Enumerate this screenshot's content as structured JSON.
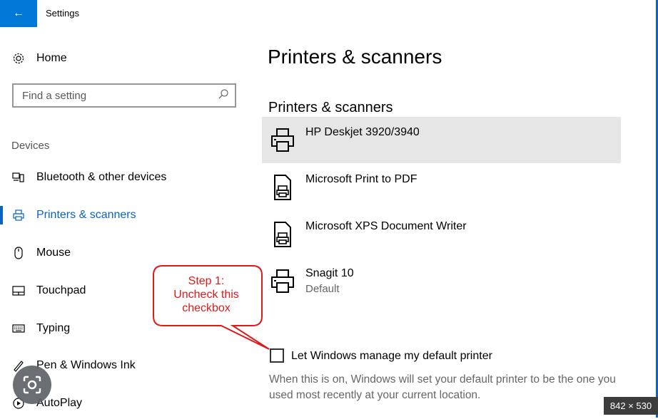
{
  "window": {
    "title": "Settings",
    "back_icon": "arrow-left-icon",
    "accent": "#0078d7"
  },
  "sidebar": {
    "home_label": "Home",
    "search": {
      "placeholder": "Find a setting",
      "value": ""
    },
    "section_label": "Devices",
    "items": [
      {
        "label": "Bluetooth & other devices",
        "icon": "bluetooth-devices-icon"
      },
      {
        "label": "Printers & scanners",
        "icon": "printer-icon",
        "active": true
      },
      {
        "label": "Mouse",
        "icon": "mouse-icon"
      },
      {
        "label": "Touchpad",
        "icon": "touchpad-icon"
      },
      {
        "label": "Typing",
        "icon": "keyboard-icon"
      },
      {
        "label": "Pen & Windows Ink",
        "icon": "pen-icon"
      },
      {
        "label": "AutoPlay",
        "icon": "autoplay-icon"
      }
    ]
  },
  "main": {
    "title": "Printers & scanners",
    "subheading": "Printers & scanners",
    "printers": [
      {
        "name": "HP Deskjet 3920/3940",
        "status": "",
        "icon": "printer-icon",
        "selected": true
      },
      {
        "name": "Microsoft Print to PDF",
        "status": "",
        "icon": "document-printer-icon"
      },
      {
        "name": "Microsoft XPS Document Writer",
        "status": "",
        "icon": "document-printer-icon"
      },
      {
        "name": "Snagit 10",
        "status": "Default",
        "icon": "printer-icon"
      }
    ],
    "default_printer_checkbox": {
      "label": "Let Windows manage my default printer",
      "checked": false,
      "description": "When this is on, Windows will set your default printer to be the one you used most recently at your current location."
    }
  },
  "callout": {
    "lines": [
      "Step 1:",
      "Uncheck this",
      "checkbox"
    ],
    "color": "#e01a1a"
  },
  "overlay": {
    "size_badge": "842 × 530",
    "lens_icon": "lens-icon"
  }
}
